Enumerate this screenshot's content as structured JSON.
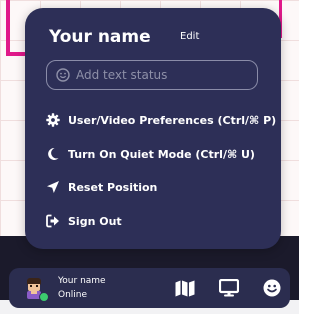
{
  "popup": {
    "user_name": "Your name",
    "edit_label": "Edit",
    "status_placeholder": "Add text status",
    "status_icon": "smiley-icon",
    "items": [
      {
        "label": "User/Video Preferences (Ctrl/⌘ P)",
        "icon": "gear-icon"
      },
      {
        "label": "Turn On Quiet Mode (Ctrl/⌘ U)",
        "icon": "moon-icon"
      },
      {
        "label": "Reset Position",
        "icon": "location-arrow-icon"
      },
      {
        "label": "Sign Out",
        "icon": "sign-out-icon"
      }
    ]
  },
  "bottom_bar": {
    "user_name": "Your name",
    "status": "Online",
    "buttons": [
      {
        "icon": "map-icon"
      },
      {
        "icon": "screen-share-icon"
      },
      {
        "icon": "smiley-icon"
      }
    ]
  },
  "colors": {
    "panel": "#2d2f57",
    "bar": "#2b2d4f",
    "accent_pink": "#e0198a",
    "online": "#3ccb6e"
  }
}
